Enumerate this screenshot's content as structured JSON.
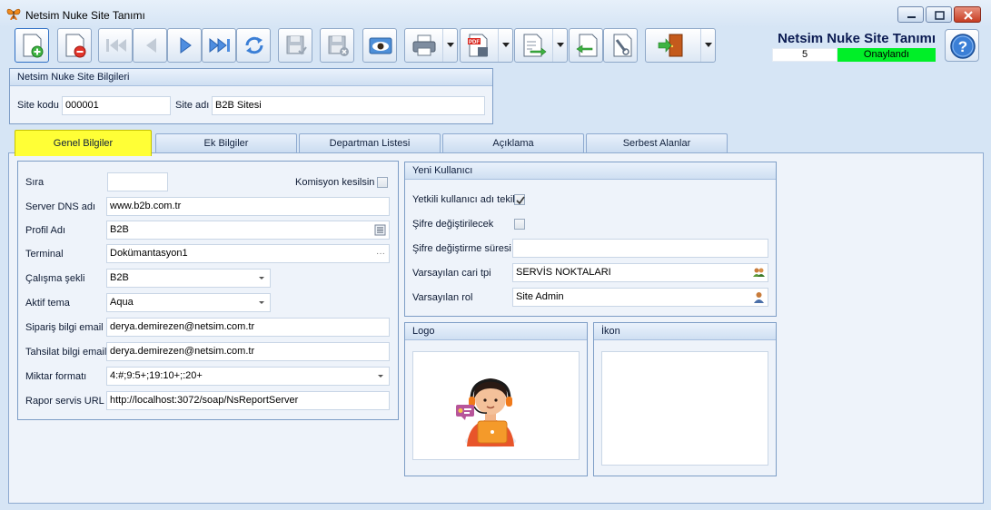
{
  "window": {
    "title": "Netsim Nuke Site Tanımı",
    "icons": [
      "butterfly-icon",
      "minimize-icon",
      "maximize-icon",
      "close-icon"
    ]
  },
  "toolbar": {
    "buttons": [
      {
        "name": "new-record",
        "icon": "new-document-icon"
      },
      {
        "name": "delete-record",
        "icon": "delete-document-icon"
      },
      {
        "name": "first-record",
        "icon": "first-icon"
      },
      {
        "name": "previous-record",
        "icon": "previous-icon"
      },
      {
        "name": "next-record",
        "icon": "next-icon"
      },
      {
        "name": "last-record",
        "icon": "last-icon"
      },
      {
        "name": "refresh",
        "icon": "refresh-icon"
      },
      {
        "name": "save",
        "icon": "save-icon"
      },
      {
        "name": "cancel-changes",
        "icon": "save-cancel-icon"
      },
      {
        "name": "preview",
        "icon": "eye-icon"
      },
      {
        "name": "print",
        "icon": "printer-icon"
      },
      {
        "name": "export-pdf",
        "icon": "pdf-icon"
      },
      {
        "name": "export",
        "icon": "export-icon"
      },
      {
        "name": "import",
        "icon": "import-icon"
      },
      {
        "name": "tools",
        "icon": "tools-icon"
      },
      {
        "name": "exit",
        "icon": "exit-door-icon"
      }
    ]
  },
  "header": {
    "title": "Netsim Nuke Site Tanımı",
    "record_number": "5",
    "status": "Onaylandı",
    "status_color": "#00ef28",
    "help_icon": "help-icon"
  },
  "site_info": {
    "title": "Netsim Nuke Site Bilgileri",
    "site_code_label": "Site kodu",
    "site_code": "000001",
    "site_name_label": "Site adı",
    "site_name": "B2B Sitesi"
  },
  "tabs": [
    {
      "label": "Genel Bilgiler",
      "active": true
    },
    {
      "label": "Ek Bilgiler",
      "active": false
    },
    {
      "label": "Departman Listesi",
      "active": false
    },
    {
      "label": "Açıklama",
      "active": false
    },
    {
      "label": "Serbest Alanlar",
      "active": false
    }
  ],
  "general": {
    "sira_label": "Sıra",
    "sira": "",
    "komisyon_label": "Komisyon kesilsin",
    "komisyon_checked": false,
    "server_dns_label": "Server DNS adı",
    "server_dns": "www.b2b.com.tr",
    "profil_label": "Profil Adı",
    "profil": "B2B",
    "terminal_label": "Terminal",
    "terminal": "Dokümantasyon1",
    "calisma_label": "Çalışma şekli",
    "calisma": "B2B",
    "tema_label": "Aktif tema",
    "tema": "Aqua",
    "siparis_email_label": "Sipariş bilgi email",
    "siparis_email": "derya.demirezen@netsim.com.tr",
    "tahsilat_email_label": "Tahsilat bilgi email",
    "tahsilat_email": "derya.demirezen@netsim.com.tr",
    "miktar_label": "Miktar formatı",
    "miktar": "4:#;9:5+;19:10+;:20+",
    "rapor_label": "Rapor servis URL",
    "rapor": "http://localhost:3072/soap/NsReportServer"
  },
  "new_user": {
    "title": "Yeni Kullanıcı",
    "yetkili_label": "Yetkili kullanıcı adı tekil",
    "yetkili_checked": true,
    "sifre_label": "Şifre değiştirilecek",
    "sifre_checked": false,
    "sure_label": "Şifre değiştirme süresi",
    "sure": "",
    "cari_label": "Varsayılan cari tpi",
    "cari": "SERVİS NOKTALARI",
    "cari_icon": "users-icon",
    "rol_label": "Varsayılan rol",
    "rol": "Site Admin",
    "rol_icon": "user-icon"
  },
  "logo": {
    "title": "Logo",
    "image": "support-agent-illustration"
  },
  "ikon": {
    "title": "İkon"
  }
}
